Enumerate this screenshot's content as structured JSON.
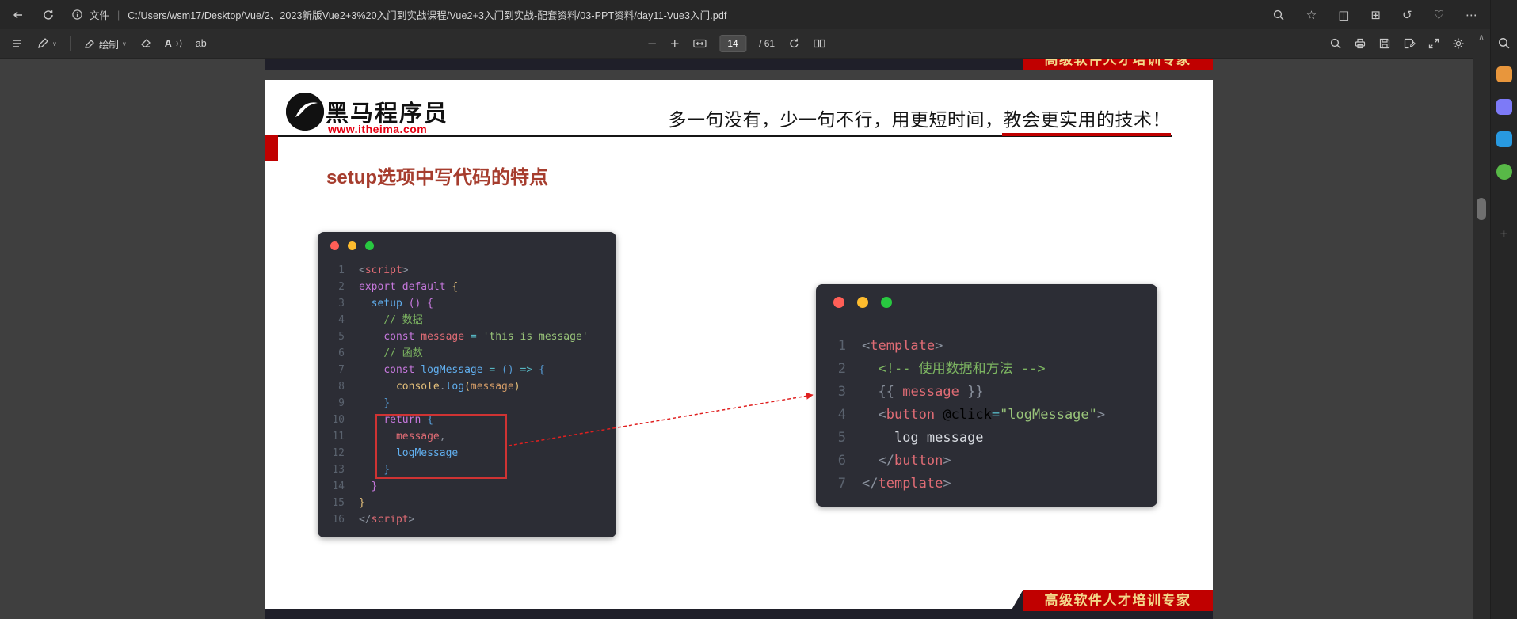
{
  "browser": {
    "address": {
      "file_label": "文件",
      "path": "C:/Users/wsm17/Desktop/Vue/2、2023新版Vue2+3%20入门到实战课程/Vue2+3入门到实战-配套资料/03-PPT资料/day11-Vue3入门.pdf"
    },
    "glyphs": {
      "star": "☆",
      "split": "◫",
      "collections": "⊞",
      "history": "↺",
      "essentials": "♡",
      "more": "⋯"
    }
  },
  "pdf_toolbar": {
    "draw_label": "绘制",
    "read_aloud_glyph": "A",
    "text_glyph": "ab",
    "chevron": "∨",
    "zoom_out": "−",
    "zoom_in": "+",
    "page_current": "14",
    "page_total": "/ 61",
    "scroll_up_glyph": "∧",
    "sidebar_plus": "+"
  },
  "slide": {
    "brand": "黑马程序员",
    "site": "www.itheima.com",
    "tagline": "多一句没有，少一句不行，用更短时间，教会更实用的技术！",
    "title": "setup选项中写代码的特点",
    "ribbon": "高级软件人才培训专家"
  },
  "left_code": {
    "lines": [
      [
        [
          "pun",
          "<"
        ],
        [
          "tag",
          "script"
        ],
        [
          "pun",
          ">"
        ]
      ],
      [
        [
          "kw",
          "export default "
        ],
        [
          "b1",
          "{"
        ]
      ],
      [
        [
          "pln",
          "  "
        ],
        [
          "fn",
          "setup "
        ],
        [
          "b2",
          "()"
        ],
        [
          "pln",
          " "
        ],
        [
          "b2",
          "{"
        ]
      ],
      [
        [
          "pln",
          "    "
        ],
        [
          "com",
          "// 数据"
        ]
      ],
      [
        [
          "pln",
          "    "
        ],
        [
          "kw",
          "const "
        ],
        [
          "var",
          "message"
        ],
        [
          "op",
          " = "
        ],
        [
          "str",
          "'this is message'"
        ]
      ],
      [
        [
          "pln",
          "    "
        ],
        [
          "com",
          "// 函数"
        ]
      ],
      [
        [
          "pln",
          "    "
        ],
        [
          "kw",
          "const "
        ],
        [
          "fn",
          "logMessage"
        ],
        [
          "op",
          " = "
        ],
        [
          "b3",
          "()"
        ],
        [
          "op",
          " => "
        ],
        [
          "b3",
          "{"
        ]
      ],
      [
        [
          "pln",
          "      "
        ],
        [
          "obj",
          "console"
        ],
        [
          "pun",
          "."
        ],
        [
          "fn",
          "log"
        ],
        [
          "b1",
          "("
        ],
        [
          "arg",
          "message"
        ],
        [
          "b1",
          ")"
        ]
      ],
      [
        [
          "pln",
          "    "
        ],
        [
          "b3",
          "}"
        ]
      ],
      [
        [
          "pln",
          "    "
        ],
        [
          "kw",
          "return "
        ],
        [
          "b3",
          "{"
        ]
      ],
      [
        [
          "pln",
          "      "
        ],
        [
          "var",
          "message"
        ],
        [
          "pun",
          ","
        ]
      ],
      [
        [
          "pln",
          "      "
        ],
        [
          "fn",
          "logMessage"
        ]
      ],
      [
        [
          "pln",
          "    "
        ],
        [
          "b3",
          "}"
        ]
      ],
      [
        [
          "pln",
          "  "
        ],
        [
          "b2",
          "}"
        ]
      ],
      [
        [
          "b1",
          "}"
        ]
      ],
      [
        [
          "pun",
          "</"
        ],
        [
          "tag",
          "script"
        ],
        [
          "pun",
          ">"
        ]
      ]
    ]
  },
  "right_code": {
    "lines": [
      [
        [
          "pun",
          "<"
        ],
        [
          "tag",
          "template"
        ],
        [
          "pun",
          ">"
        ]
      ],
      [
        [
          "pln",
          "  "
        ],
        [
          "com",
          "<!-- 使用数据和方法 -->"
        ]
      ],
      [
        [
          "pln",
          "  "
        ],
        [
          "pun",
          "{{ "
        ],
        [
          "var",
          "message"
        ],
        [
          "pun",
          " }}"
        ]
      ],
      [
        [
          "pln",
          "  "
        ],
        [
          "pun",
          "<"
        ],
        [
          "tag",
          "button"
        ],
        [
          "attr",
          " @click"
        ],
        [
          "op",
          "="
        ],
        [
          "str",
          "\"logMessage\""
        ],
        [
          "pun",
          ">"
        ]
      ],
      [
        [
          "pln",
          "    "
        ],
        [
          "txt",
          "log message"
        ]
      ],
      [
        [
          "pln",
          "  "
        ],
        [
          "pun",
          "</"
        ],
        [
          "tag",
          "button"
        ],
        [
          "pun",
          ">"
        ]
      ],
      [
        [
          "pun",
          "</"
        ],
        [
          "tag",
          "template"
        ],
        [
          "pun",
          ">"
        ]
      ]
    ]
  },
  "colors": {
    "accent_red": "#c00000",
    "brand_red": "#e60012",
    "title_red": "#a63d2e",
    "code_bg": "#2c2d35",
    "ribbon_gold": "#f3d88a"
  }
}
